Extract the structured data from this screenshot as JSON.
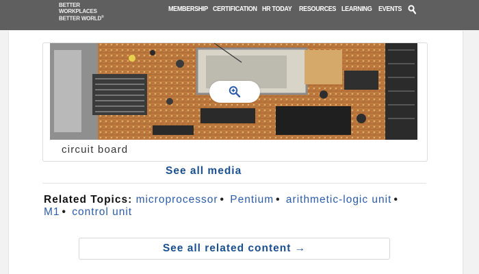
{
  "header": {
    "logo_line1": "BETTER WORKPLACES",
    "logo_line2": "BETTER WORLD",
    "logo_mark": "®",
    "nav": [
      "MEMBERSHIP",
      "CERTIFICATION",
      "HR TODAY",
      "RESOURCES",
      "LEARNING",
      "EVENTS"
    ],
    "search_icon": "search-icon"
  },
  "media": {
    "caption": "circuit board",
    "zoom_icon": "magnifier-plus-icon",
    "see_all_label": "See all media"
  },
  "related": {
    "label": "Related Topics:",
    "topics": [
      "microprocessor",
      "Pentium",
      "arithmetic-logic unit",
      "M1",
      "control unit"
    ],
    "separator": "•",
    "see_all_label": "See all related content →"
  },
  "colors": {
    "header_bg": "#5f5f5f",
    "link": "#2a5ba8",
    "button_text": "#1a4f8f"
  }
}
